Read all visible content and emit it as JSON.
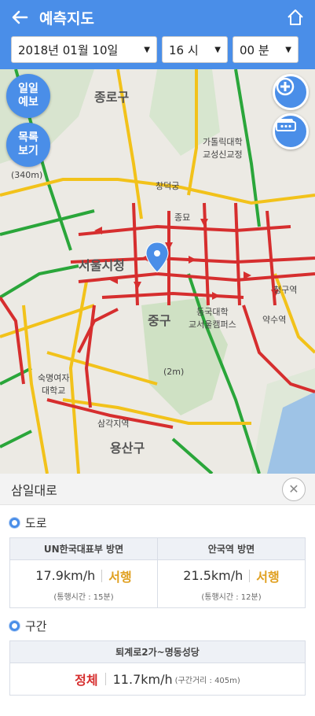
{
  "header": {
    "title": "예측지도"
  },
  "selects": {
    "date": "2018년 01월 10일",
    "hour": "16 시",
    "minute": "00 분"
  },
  "map": {
    "buttons": {
      "daily": "일일\n예보",
      "list": "목록\n보기"
    },
    "labels": {
      "jongno": "종로구",
      "seoul_cityhall": "서울시청",
      "junggu": "중구",
      "yongsan": "용산구",
      "changdeok": "창덕궁",
      "jongmyo": "종묘",
      "sookmyung": "숙명여자\n대학교",
      "samgakji": "삼각지역",
      "cheonggu": "청구역",
      "yaksu": "약수역",
      "dongguk": "동국대학\n교서울캠퍼스",
      "hwahwa": "가톨릭대학\n교성신교정",
      "elev": "(340m)",
      "namsan": "(2m)"
    }
  },
  "panel": {
    "road_name": "삼일대로",
    "road_section_label": "도로",
    "directions": [
      {
        "name": "UN한국대표부 방면",
        "speed": "17.9km/h",
        "dir": "서행",
        "time": "(통행시간 : 15분)"
      },
      {
        "name": "안국역 방면",
        "speed": "21.5km/h",
        "dir": "서행",
        "time": "(통행시간 : 12분)"
      }
    ],
    "segment_label": "구간",
    "segment": {
      "name": "퇴계로2가~명동성당",
      "status": "정체",
      "speed": "11.7km/h",
      "dist": "(구간거리 : 405m)"
    }
  },
  "colors": {
    "header": "#4a8ee8",
    "congested": "#d62e2e",
    "slow": "#e0a020",
    "free": "#2aa63a"
  }
}
